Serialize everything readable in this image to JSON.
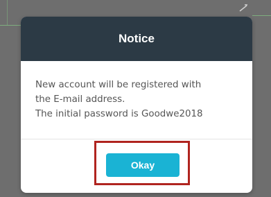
{
  "dialog": {
    "title": "Notice",
    "message_lines": [
      "New account will be registered with",
      "the E-mail address.",
      "The initial password is Goodwe2018"
    ],
    "okay_label": "Okay"
  },
  "colors": {
    "header_bg": "#2c3a45",
    "button_bg": "#1ab3d4",
    "highlight_border": "#b0241f",
    "overlay": "#6e6e6e"
  }
}
